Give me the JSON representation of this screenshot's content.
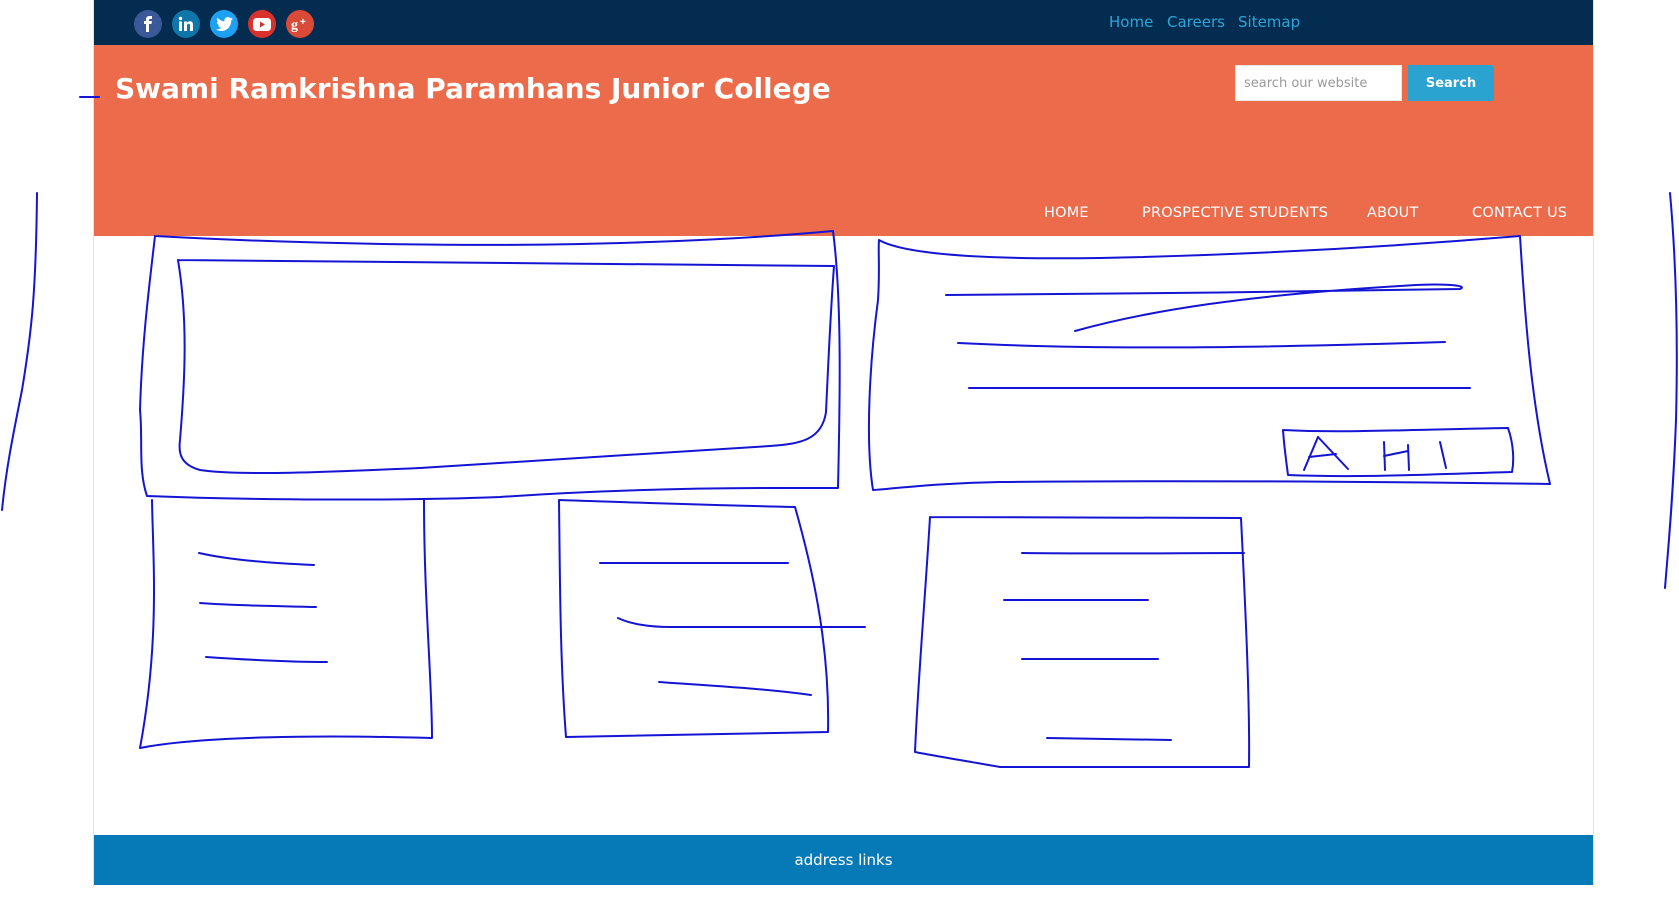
{
  "topbar": {
    "social": [
      {
        "icon": "facebook-icon",
        "color": "#3b5998"
      },
      {
        "icon": "linkedin-icon",
        "color": "#0e76a8"
      },
      {
        "icon": "twitter-icon",
        "color": "#1da1f2"
      },
      {
        "icon": "youtube-icon",
        "color": "#d9322c"
      },
      {
        "icon": "google-plus-icon",
        "color": "#d94a38"
      }
    ],
    "links": {
      "home": "Home",
      "careers": "Careers",
      "sitemap": "Sitemap"
    }
  },
  "header": {
    "title": "Swami Ramkrishna Paramhans Junior College",
    "search": {
      "placeholder": "search our website",
      "button": "Search"
    },
    "nav": {
      "home": "HOME",
      "prospective": "PROSPECTIVE STUDENTS",
      "about": "ABOUT",
      "contact": "CONTACT US"
    }
  },
  "sketch": {
    "button_label": "A HI"
  },
  "footer": {
    "text": "address links"
  },
  "colors": {
    "topbar": "#042c50",
    "header": "#eb6b4b",
    "link": "#2aa6d8",
    "search_button": "#2aa3d1",
    "footer": "#057ab6",
    "sketch_ink": "#1414d4"
  }
}
